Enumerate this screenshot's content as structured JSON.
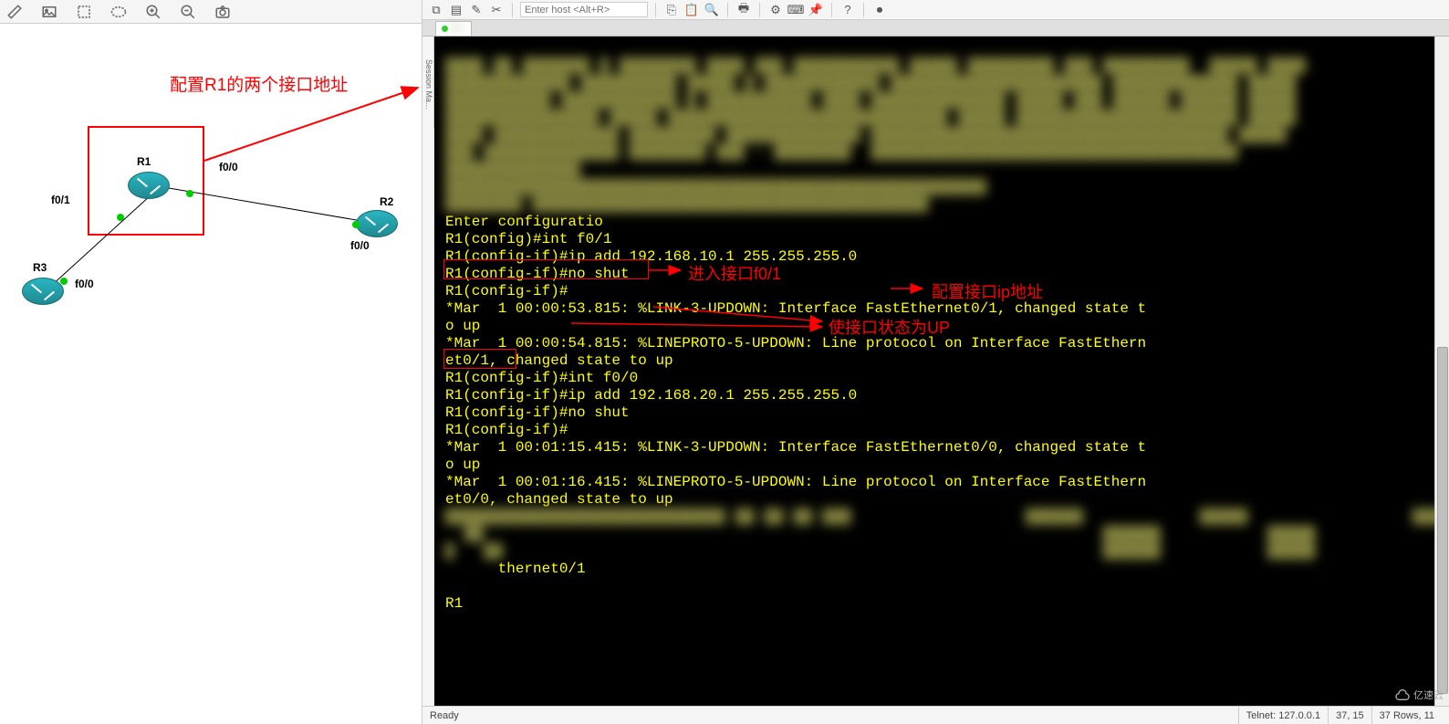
{
  "topology": {
    "annotation_title": "配置R1的两个接口地址",
    "nodes": {
      "r1": {
        "label": "R1"
      },
      "r2": {
        "label": "R2"
      },
      "r3": {
        "label": "R3"
      }
    },
    "interfaces": {
      "r1_f00": "f0/0",
      "r1_f01": "f0/1",
      "r2_f00": "f0/0",
      "r3_f00": "f0/0"
    }
  },
  "toolbar_right": {
    "host_placeholder": "Enter host <Alt+R>"
  },
  "session_panel": "Session Ma...",
  "terminal": {
    "annotations": {
      "a1": "进入接口f0/1",
      "a2": "配置接口ip地址",
      "a3": "使接口状态为UP"
    },
    "lines": {
      "l0": " ",
      "l1": "Enter configuratio",
      "l2": "R1(config)#int f0/1",
      "l3": "R1(config-if)#ip add 192.168.10.1 255.255.255.0",
      "l4": "R1(config-if)#no shut",
      "l5": "R1(config-if)#",
      "l6": "*Mar  1 00:00:53.815: %LINK-3-UPDOWN: Interface FastEthernet0/1, changed state t",
      "l7": "o up",
      "l8": "*Mar  1 00:00:54.815: %LINEPROTO-5-UPDOWN: Line protocol on Interface FastEthern",
      "l9": "et0/1, changed state to up",
      "l10": "R1(config-if)#int f0/0",
      "l11": "R1(config-if)#ip add 192.168.20.1 255.255.255.0",
      "l12": "R1(config-if)#no shut",
      "l13": "R1(config-if)#",
      "l14": "*Mar  1 00:01:15.415: %LINK-3-UPDOWN: Interface FastEthernet0/0, changed state t",
      "l15": "o up",
      "l16": "*Mar  1 00:01:16.415: %LINEPROTO-5-UPDOWN: Line protocol on Interface FastEthern",
      "l17": "et0/0, changed state to up",
      "l18": "      thernet0/1",
      "l19": "R1"
    }
  },
  "status": {
    "ready": "Ready",
    "proto": "Telnet: 127.0.0.1",
    "pos": "37,  15",
    "size": "37 Rows, 11"
  },
  "watermark": "亿速云"
}
